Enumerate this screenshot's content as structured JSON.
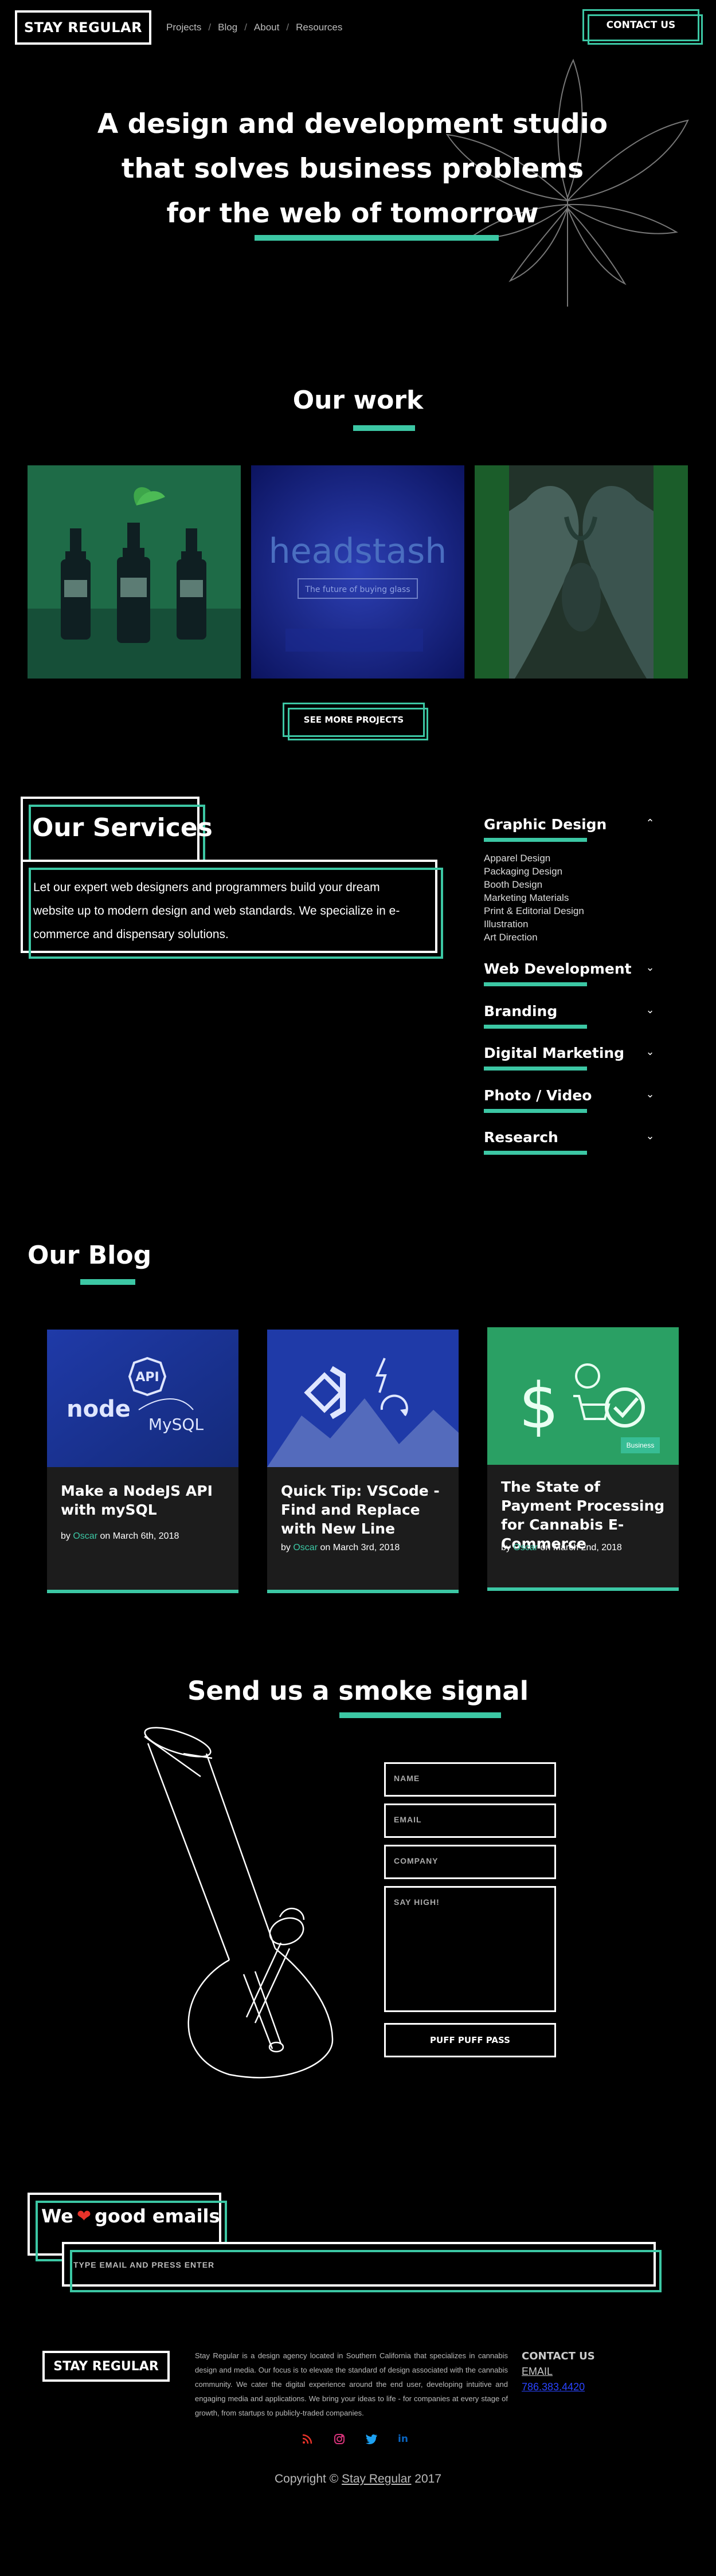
{
  "header": {
    "logo": "STAY REGULAR",
    "nav": [
      "Projects",
      "Blog",
      "About",
      "Resources"
    ],
    "nav_separator": "/",
    "contact_button": "CONTACT US"
  },
  "hero": {
    "line1": "A design and development studio",
    "line2": "that solves business problems",
    "line3": "for the web of tomorrow"
  },
  "work": {
    "title": "Our work",
    "projects": [
      {
        "name": "tincture-bottles-project",
        "image_icon": "bottles-image"
      },
      {
        "name": "headstash-project",
        "headline": "headstash",
        "tagline": "The future of buying glass"
      },
      {
        "name": "hands-project",
        "image_icon": "hands-image"
      }
    ],
    "see_more": "SEE MORE PROJECTS"
  },
  "services": {
    "title": "Our Services",
    "description": "Let our expert web designers and programmers build your dream website up to modern design and web standards. We specialize in e-commerce and dispensary solutions.",
    "categories": [
      {
        "label": "Graphic Design",
        "expanded": true,
        "chevron": "chevron-up-icon"
      },
      {
        "label": "Web Development",
        "chevron": "chevron-down-icon"
      },
      {
        "label": "Branding",
        "chevron": "chevron-down-icon"
      },
      {
        "label": "Digital Marketing",
        "chevron": "chevron-down-icon"
      },
      {
        "label": "Photo / Video",
        "chevron": "chevron-down-icon"
      },
      {
        "label": "Research",
        "chevron": "chevron-down-icon"
      }
    ],
    "graphic_design_items": [
      "Apparel Design",
      "Packaging Design",
      "Booth Design",
      "Marketing Materials",
      "Print & Editorial Design",
      "Illustration",
      "Art Direction"
    ]
  },
  "blog": {
    "title": "Our Blog",
    "by": "by",
    "on": "on",
    "posts": [
      {
        "title": "Make a NodeJS API with mySQL",
        "author": "Oscar",
        "date": "March 6th, 2018",
        "image_labels": [
          "node",
          "API",
          "MySQL"
        ]
      },
      {
        "title": "Quick Tip: VSCode - Find and Replace with New Line",
        "author": "Oscar",
        "date": "March 3rd, 2018"
      },
      {
        "title": "The State of Payment Processing for Cannabis E-Commerce",
        "author": "Oscar",
        "date": "March 2nd, 2018",
        "badge": "Business"
      }
    ]
  },
  "contact": {
    "title": "Send us a smoke signal",
    "name_placeholder": "NAME",
    "email_placeholder": "EMAIL",
    "company_placeholder": "COMPANY",
    "message_placeholder": "SAY HIGH!",
    "submit": "PUFF PUFF PASS"
  },
  "newsletter": {
    "title_pre": "We",
    "heart": "❤",
    "title_post": "good emails",
    "placeholder": "TYPE EMAIL AND PRESS ENTER"
  },
  "footer": {
    "logo": "STAY REGULAR",
    "about": "Stay Regular is a design agency located in Southern California that specializes in cannabis design and media. Our focus is to elevate the standard of design associated with the cannabis community. We cater the digital experience around the end user, developing intuitive and engaging media and applications. We bring your ideas to life - for companies at every stage of growth, from startups to publicly-traded companies.",
    "contact_heading": "CONTACT US",
    "email_label": "EMAIL",
    "phone": "786.383.4420",
    "social": [
      {
        "icon": "rss-icon",
        "color": "#e8332a"
      },
      {
        "icon": "instagram-icon",
        "color": "#d6337a"
      },
      {
        "icon": "twitter-icon",
        "color": "#1da1f2"
      },
      {
        "icon": "linkedin-icon",
        "color": "#0a66c2"
      }
    ],
    "copyright_pre": "Copyright ©",
    "copyright_link": "Stay Regular",
    "copyright_year": "2017"
  },
  "colors": {
    "accent": "#3cc7a4",
    "background": "#000000"
  }
}
